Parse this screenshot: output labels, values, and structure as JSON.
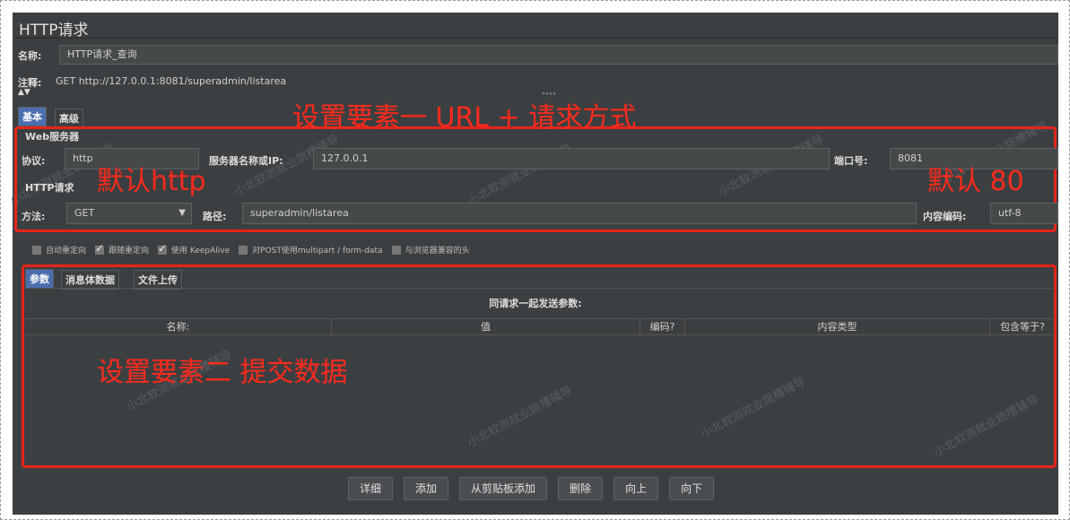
{
  "panel_title": "HTTP请求",
  "name_row": {
    "label": "名称:",
    "value": "HTTP请求_查询"
  },
  "comment_row": {
    "label": "注释:",
    "value": "GET http://127.0.0.1:8081/superadmin/listarea"
  },
  "collapse_marker": "▲▼",
  "tabs": [
    {
      "label": "基本"
    },
    {
      "label": "高级"
    }
  ],
  "web_server": {
    "section_label": "Web服务器",
    "protocol_label": "协议:",
    "protocol_value": "http",
    "server_label": "服务器名称或IP:",
    "server_value": "127.0.0.1",
    "port_label": "端口号:",
    "port_value": "8081"
  },
  "http_request": {
    "section_label": "HTTP请求",
    "method_label": "方法:",
    "method_value": "GET",
    "path_label": "路径:",
    "path_value": "superadmin/listarea",
    "encoding_label": "内容编码:",
    "encoding_value": "utf-8"
  },
  "options": [
    {
      "label": "自动重定向",
      "checked": false
    },
    {
      "label": "跟随重定向",
      "checked": true
    },
    {
      "label": "使用 KeepAlive",
      "checked": true
    },
    {
      "label": "对POST使用multipart / form-data",
      "checked": false
    },
    {
      "label": "与浏览器兼容的头",
      "checked": false
    }
  ],
  "param_tabs": [
    {
      "label": "参数"
    },
    {
      "label": "消息体数据"
    },
    {
      "label": "文件上传"
    }
  ],
  "params_heading": "同请求一起发送参数:",
  "table_headers": [
    "名称:",
    "值",
    "编码?",
    "内容类型",
    "包含等于?"
  ],
  "buttons": [
    {
      "label": "详细"
    },
    {
      "label": "添加"
    },
    {
      "label": "从剪贴板添加"
    },
    {
      "label": "删除"
    },
    {
      "label": "向上"
    },
    {
      "label": "向下"
    }
  ],
  "annotations": {
    "url_method": "设置要素一 URL + 请求方式",
    "default_http": "默认http",
    "default_port": "默认 80",
    "submit_data": "设置要素二 提交数据"
  },
  "watermark": "小北软测就业跳槽辅导",
  "colors": {
    "annotation": "#ff2a1c",
    "panel_bg": "#3c3f41",
    "active_tab": "#4b6eaf"
  }
}
